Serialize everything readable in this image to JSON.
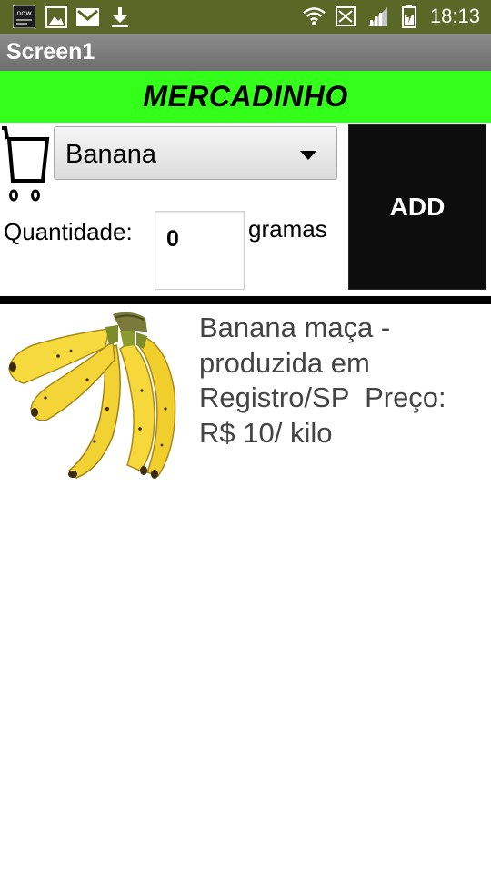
{
  "status_bar": {
    "time": "18:13",
    "left_icons": [
      "now-app-icon",
      "image-icon",
      "gmail-icon",
      "download-icon"
    ],
    "right_icons": [
      "wifi-icon",
      "sms-icon",
      "signal-icon",
      "battery-icon"
    ],
    "now_app_text": "now"
  },
  "title_bar": {
    "title": "Screen1"
  },
  "banner": {
    "text": "MERCADINHO",
    "color": "#33ff1a"
  },
  "product_picker": {
    "selected": "Banana"
  },
  "quantity": {
    "label": "Quantidade:",
    "value": "0",
    "unit": "gramas"
  },
  "add_button": {
    "label": "ADD"
  },
  "product": {
    "image": "banana-bunch",
    "description": "Banana maça -\nproduzida em\nRegistro/SP  Preço:\nR$ 10/ kilo"
  }
}
